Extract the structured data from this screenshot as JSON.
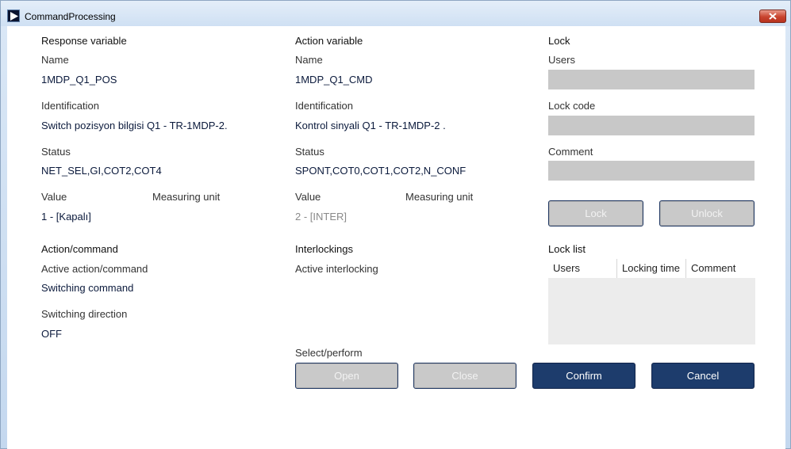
{
  "window": {
    "title": "CommandProcessing"
  },
  "response": {
    "heading": "Response variable",
    "name_label": "Name",
    "name_value": "1MDP_Q1_POS",
    "id_label": "Identification",
    "id_value": "Switch pozisyon bilgisi Q1 - TR-1MDP-2.",
    "status_label": "Status",
    "status_value": "NET_SEL,GI,COT2,COT4",
    "value_label": "Value",
    "unit_label": "Measuring unit",
    "value_value": "1 - [Kapalı]"
  },
  "action": {
    "heading": "Action variable",
    "name_label": "Name",
    "name_value": "1MDP_Q1_CMD",
    "id_label": "Identification",
    "id_value": "Kontrol sinyali Q1 - TR-1MDP-2 .",
    "status_label": "Status",
    "status_value": "SPONT,COT0,COT1,COT2,N_CONF",
    "value_label": "Value",
    "unit_label": "Measuring unit",
    "value_value": "2 - [INTER]"
  },
  "lock": {
    "heading": "Lock",
    "users_label": "Users",
    "users_value": "",
    "code_label": "Lock code",
    "code_value": "",
    "comment_label": "Comment",
    "comment_value": "",
    "lock_button": "Lock",
    "unlock_button": "Unlock"
  },
  "action_command": {
    "heading": "Action/command",
    "active_label": "Active action/command",
    "active_value": "Switching command",
    "direction_label": "Switching direction",
    "direction_value": "OFF"
  },
  "interlockings": {
    "heading": "Interlockings",
    "active_label": "Active interlocking"
  },
  "lock_list": {
    "heading": "Lock list",
    "columns": [
      "Users",
      "Locking time",
      "Comment"
    ]
  },
  "select_perform": {
    "heading": "Select/perform",
    "open": "Open",
    "close": "Close",
    "confirm": "Confirm",
    "cancel": "Cancel"
  }
}
